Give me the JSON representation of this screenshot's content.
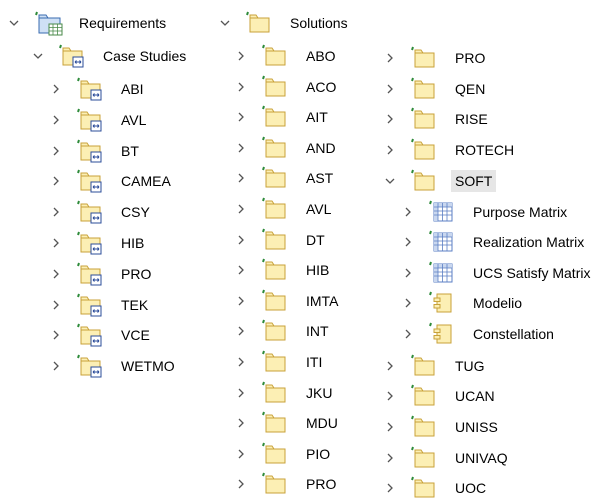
{
  "col1": {
    "root": {
      "label": "Requirements",
      "icon": "requirements-package-icon"
    },
    "case_studies": {
      "label": "Case Studies",
      "icon": "package-icon"
    },
    "items": [
      {
        "label": "ABI"
      },
      {
        "label": "AVL"
      },
      {
        "label": "BT"
      },
      {
        "label": "CAMEA"
      },
      {
        "label": "CSY"
      },
      {
        "label": "HIB"
      },
      {
        "label": "PRO"
      },
      {
        "label": "TEK"
      },
      {
        "label": "VCE"
      },
      {
        "label": "WETMO"
      }
    ]
  },
  "col2": {
    "root": {
      "label": "Solutions",
      "icon": "folder-icon"
    },
    "items": [
      {
        "label": "ABO"
      },
      {
        "label": "ACO"
      },
      {
        "label": "AIT"
      },
      {
        "label": "AND"
      },
      {
        "label": "AST"
      },
      {
        "label": "AVL"
      },
      {
        "label": "DT"
      },
      {
        "label": "HIB"
      },
      {
        "label": "IMTA"
      },
      {
        "label": "INT"
      },
      {
        "label": "ITI"
      },
      {
        "label": "JKU"
      },
      {
        "label": "MDU"
      },
      {
        "label": "PIO"
      },
      {
        "label": "PRO"
      }
    ]
  },
  "col3": {
    "top_items": [
      {
        "label": "PRO"
      },
      {
        "label": "QEN"
      },
      {
        "label": "RISE"
      },
      {
        "label": "ROTECH"
      }
    ],
    "soft": {
      "label": "SOFT"
    },
    "soft_children": [
      {
        "label": "Purpose Matrix",
        "icon": "matrix-icon"
      },
      {
        "label": "Realization Matrix",
        "icon": "matrix-icon"
      },
      {
        "label": "UCS Satisfy Matrix",
        "icon": "matrix-icon"
      },
      {
        "label": "Modelio",
        "icon": "component-icon"
      },
      {
        "label": "Constellation",
        "icon": "component-icon"
      }
    ],
    "bottom_items": [
      {
        "label": "TUG"
      },
      {
        "label": "UCAN"
      },
      {
        "label": "UNISS"
      },
      {
        "label": "UNIVAQ"
      },
      {
        "label": "UOC"
      }
    ]
  },
  "colors": {
    "folder_fill": "#fcefb4",
    "folder_stroke": "#c8a23a",
    "marker_green": "#2e8b3a",
    "chevron": "#555555",
    "selection": "#e6e6e6",
    "matrix_blue": "#5b7fc4"
  }
}
